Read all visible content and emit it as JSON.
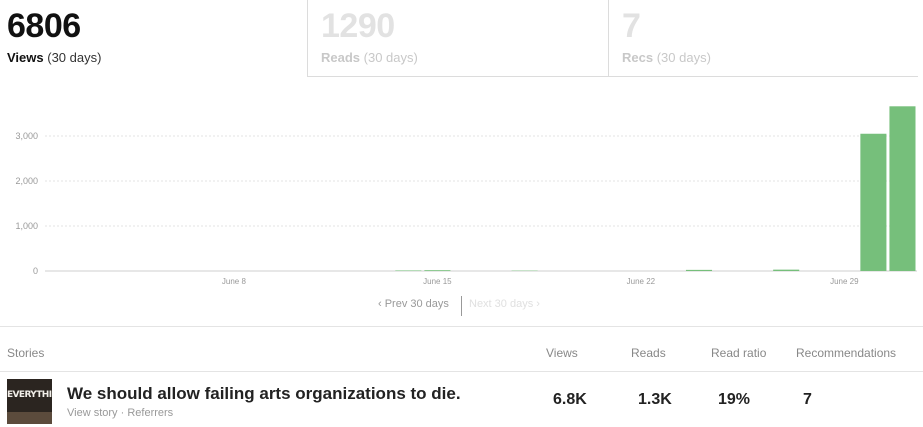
{
  "stats": {
    "views": {
      "value": "6806",
      "label": "Views",
      "period": "(30 days)"
    },
    "reads": {
      "value": "1290",
      "label": "Reads",
      "period": "(30 days)"
    },
    "recs": {
      "value": "7",
      "label": "Recs",
      "period": "(30 days)"
    }
  },
  "chart_data": {
    "type": "bar",
    "yticks": [
      0,
      1000,
      2000,
      3000
    ],
    "ytick_labels": [
      "0",
      "1,000",
      "2,000",
      "3,000"
    ],
    "ylim": [
      0,
      3700
    ],
    "xtick_labels": [
      {
        "label": "June 8",
        "day": 6
      },
      {
        "label": "June 15",
        "day": 13
      },
      {
        "label": "June 22",
        "day": 20
      },
      {
        "label": "June 29",
        "day": 27
      }
    ],
    "values": [
      0,
      0,
      0,
      0,
      0,
      0,
      0,
      0,
      0,
      0,
      0,
      0,
      12,
      18,
      0,
      0,
      8,
      0,
      0,
      0,
      0,
      0,
      25,
      0,
      0,
      30,
      0,
      0,
      3050,
      3660
    ],
    "grid": true,
    "color": "#76bf7b",
    "title": "",
    "xlabel": "",
    "ylabel": ""
  },
  "pager": {
    "prev": "‹ Prev 30 days",
    "next": "Next 30 days ›"
  },
  "table": {
    "headers": {
      "stories": "Stories",
      "views": "Views",
      "reads": "Reads",
      "ratio": "Read ratio",
      "recs": "Recommendations"
    },
    "rows": [
      {
        "title": "We should allow failing arts organizations to die.",
        "view_story": "View story",
        "sep": "·",
        "referrers": "Referrers",
        "views": "6.8K",
        "reads": "1.3K",
        "ratio": "19%",
        "recs": "7",
        "thumb_text": "EVERYTHING GOING TO BE OK"
      }
    ]
  }
}
